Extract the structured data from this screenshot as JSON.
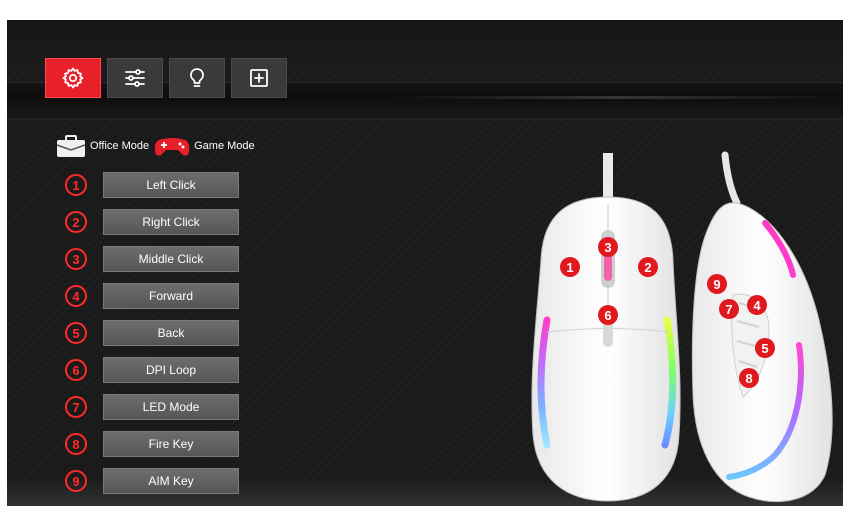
{
  "toolbar": {
    "buttons": [
      {
        "icon": "gear-icon",
        "active": true
      },
      {
        "icon": "sliders-icon",
        "active": false
      },
      {
        "icon": "lightbulb-icon",
        "active": false
      },
      {
        "icon": "macro-plus-icon",
        "active": false
      }
    ]
  },
  "modes": {
    "office_label": "Office Mode",
    "game_label": "Game Mode"
  },
  "keys": [
    {
      "num": "1",
      "label": "Left Click"
    },
    {
      "num": "2",
      "label": "Right Click"
    },
    {
      "num": "3",
      "label": "Middle Click"
    },
    {
      "num": "4",
      "label": "Forward"
    },
    {
      "num": "5",
      "label": "Back"
    },
    {
      "num": "6",
      "label": "DPI Loop"
    },
    {
      "num": "7",
      "label": "LED Mode"
    },
    {
      "num": "8",
      "label": "Fire Key"
    },
    {
      "num": "9",
      "label": "AIM Key"
    }
  ],
  "mouse_markers": {
    "top_view": [
      "1",
      "2",
      "3",
      "6"
    ],
    "side_view": [
      "9",
      "7",
      "4",
      "5",
      "8"
    ]
  },
  "colors": {
    "accent": "#e8202a",
    "number_red": "#ff2a2a",
    "background": "#1a1a1a",
    "button_gray": "#5e5e5e"
  }
}
